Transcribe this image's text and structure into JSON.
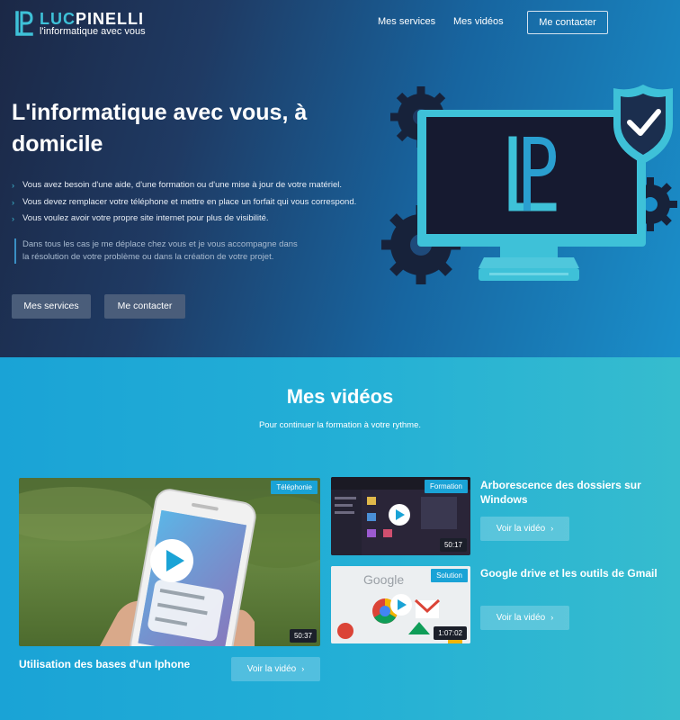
{
  "header": {
    "logo": {
      "name_light": "LUC",
      "name_bold": "PINELLI",
      "tagline": "l'informatique avec vous"
    },
    "nav": {
      "services": "Mes services",
      "videos": "Mes vidéos",
      "contact": "Me contacter"
    }
  },
  "hero": {
    "title": "L'informatique avec vous, à domicile",
    "bullets": [
      "Vous avez besoin d'une aide, d'une formation ou d'une mise à jour de votre matériel.",
      "Vous devez remplacer votre téléphone et mettre en place un forfait qui vous correspond.",
      "Vous voulez avoir votre propre site internet pour plus de visibilité."
    ],
    "quote": "Dans tous les cas je me déplace chez vous et je vous accompagne dans la résolution de votre problème ou dans la création de votre projet.",
    "btn_services": "Mes services",
    "btn_contact": "Me contacter"
  },
  "videos": {
    "title": "Mes vidéos",
    "subtitle": "Pour continuer la formation à votre rythme.",
    "watch_label": "Voir la vidéo",
    "items": [
      {
        "title": "Utilisation des bases d'un Iphone",
        "category": "Téléphonie",
        "duration": "50:37"
      },
      {
        "title": "Arborescence des dossiers sur Windows",
        "category": "Formation",
        "duration": "50:17"
      },
      {
        "title": "Google drive et les outils de Gmail",
        "category": "Solution",
        "duration": "1:07:02"
      }
    ]
  },
  "colors": {
    "accent": "#3ec1d8",
    "hero_dark": "#1b2846",
    "section_blue": "#1aa3d6"
  },
  "icons": {
    "bullet": "chevron-right-icon",
    "play": "play-icon",
    "shield": "shield-check-icon"
  }
}
